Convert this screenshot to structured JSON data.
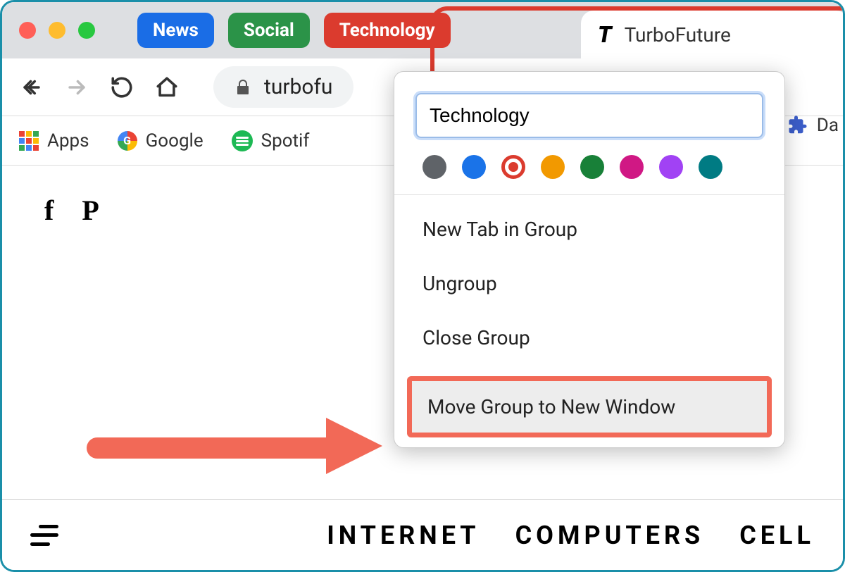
{
  "tab_groups": [
    {
      "label": "News",
      "color": "#1a6de6"
    },
    {
      "label": "Social",
      "color": "#2b9348"
    },
    {
      "label": "Technology",
      "color": "#db3b2e"
    }
  ],
  "active_tab": {
    "title": "TurboFuture"
  },
  "address_bar": {
    "url_fragment": "turbofu"
  },
  "bookmarks": {
    "apps": "Apps",
    "google": "Google",
    "spotify": "Spotif",
    "partial_right": "Da"
  },
  "group_menu": {
    "name_input": "Technology",
    "colors": [
      {
        "name": "grey",
        "hex": "#5f6368",
        "selected": false
      },
      {
        "name": "blue",
        "hex": "#1a73e8",
        "selected": false
      },
      {
        "name": "red",
        "hex": "#db3b2e",
        "selected": true
      },
      {
        "name": "orange",
        "hex": "#f29900",
        "selected": false
      },
      {
        "name": "green",
        "hex": "#188038",
        "selected": false
      },
      {
        "name": "pink",
        "hex": "#d01884",
        "selected": false
      },
      {
        "name": "purple",
        "hex": "#a142f4",
        "selected": false
      },
      {
        "name": "cyan",
        "hex": "#007b83",
        "selected": false
      }
    ],
    "items": {
      "new_tab": "New Tab in Group",
      "ungroup": "Ungroup",
      "close": "Close Group",
      "move": "Move Group to New Window"
    }
  },
  "page_nav": {
    "internet": "INTERNET",
    "computers": "COMPUTERS",
    "cell": "CELL"
  }
}
